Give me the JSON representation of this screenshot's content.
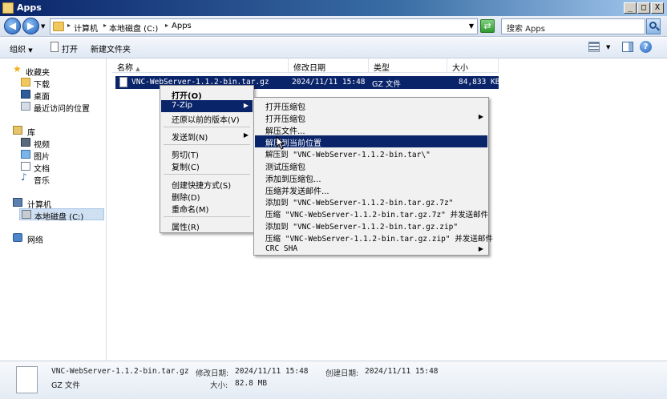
{
  "window": {
    "title": "Apps",
    "controls": {
      "minimize": "_",
      "maximize": "□",
      "close": "X"
    }
  },
  "addressbar": {
    "crumbs": [
      "计算机",
      "本地磁盘 (C:)",
      "Apps"
    ],
    "search_placeholder": "搜索 Apps"
  },
  "toolbar": {
    "organize": "组织",
    "open": "打开",
    "new_folder": "新建文件夹"
  },
  "nav": {
    "favorites": "收藏夹",
    "downloads": "下载",
    "desktop": "桌面",
    "recent": "最近访问的位置",
    "libraries": "库",
    "videos": "视频",
    "pictures": "图片",
    "documents": "文档",
    "music": "音乐",
    "computer": "计算机",
    "local_disk": "本地磁盘 (C:)",
    "network": "网络"
  },
  "columns": {
    "name": "名称",
    "modified": "修改日期",
    "type": "类型",
    "size": "大小"
  },
  "file": {
    "name": "VNC-WebServer-1.1.2-bin.tar.gz",
    "name_visible": "VNC-WebServer-1.1.2-bin.tar.gz",
    "modified": "2024/11/11 15:48",
    "type": "GZ 文件",
    "size": "84,833 KB"
  },
  "context_menu": {
    "open": "打开(O)",
    "seven_zip": "7-Zip",
    "restore": "还原以前的版本(V)",
    "send_to": "发送到(N)",
    "cut": "剪切(T)",
    "copy": "复制(C)",
    "create_shortcut": "创建快捷方式(S)",
    "delete": "删除(D)",
    "rename": "重命名(M)",
    "properties": "属性(R)"
  },
  "submenu_7zip": {
    "items": [
      "打开压缩包",
      "打开压缩包",
      "解压文件...",
      "解压到当前位置",
      "解压到 \"VNC-WebServer-1.1.2-bin.tar\\\"",
      "测试压缩包",
      "添加到压缩包...",
      "压缩并发送邮件...",
      "添加到 \"VNC-WebServer-1.1.2-bin.tar.gz.7z\"",
      "压缩 \"VNC-WebServer-1.1.2-bin.tar.gz.7z\" 并发送邮件",
      "添加到 \"VNC-WebServer-1.1.2-bin.tar.gz.zip\"",
      "压缩 \"VNC-WebServer-1.1.2-bin.tar.gz.zip\" 并发送邮件",
      "CRC SHA"
    ]
  },
  "details": {
    "filename": "VNC-WebServer-1.1.2-bin.tar.gz",
    "modified_label": "修改日期:",
    "modified": "2024/11/11 15:48",
    "created_label": "创建日期:",
    "created": "2024/11/11 15:48",
    "type": "GZ 文件",
    "size_label": "大小:",
    "size": "82.8 MB"
  },
  "colors": {
    "selection": "#0a246a",
    "title_start": "#0a246a",
    "nav_selected": "#cfe0f3"
  },
  "icons": [
    "folder-icon",
    "back-icon",
    "forward-icon",
    "refresh-icon",
    "search-icon",
    "help-icon",
    "star-icon",
    "music-note-icon",
    "network-icon",
    "archive-file-icon"
  ]
}
